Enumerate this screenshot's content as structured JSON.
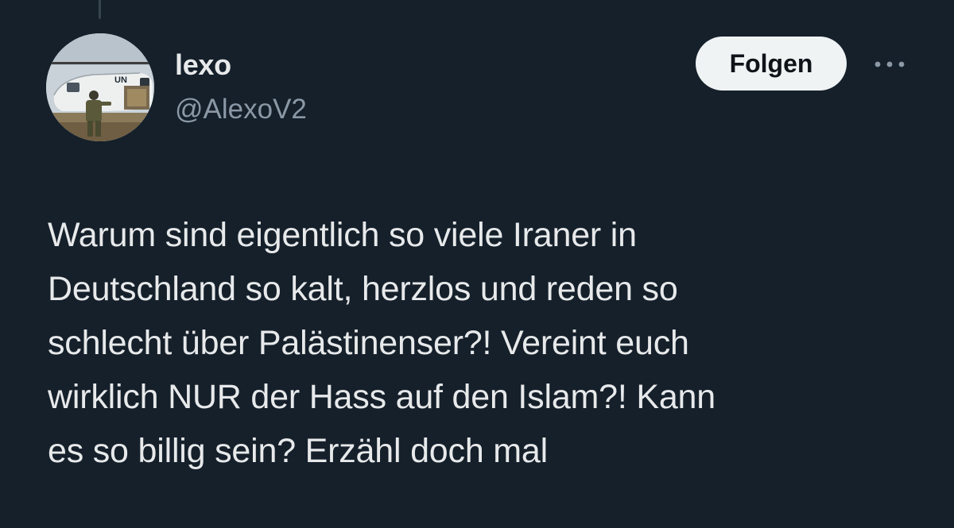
{
  "tweet": {
    "author": {
      "display_name": "lexo",
      "handle": "@AlexoV2",
      "avatar_icon": "avatar-helicopter-photo",
      "avatar_text": "UN"
    },
    "follow_label": "Folgen",
    "more_icon": "more-horizontal-icon",
    "text_lines": [
      "Warum sind eigentlich so viele Iraner in",
      "Deutschland so kalt, herzlos und reden so",
      "schlecht über Palästinenser?! Vereint euch",
      "wirklich NUR der Hass auf den Islam?! Kann",
      "es so billig sein? Erzähl doch mal"
    ]
  },
  "colors": {
    "background": "#15202b",
    "primary_text": "#e7e9ea",
    "secondary_text": "#8b98a5",
    "follow_button_bg": "#eff3f4",
    "follow_button_text": "#0f1419"
  }
}
